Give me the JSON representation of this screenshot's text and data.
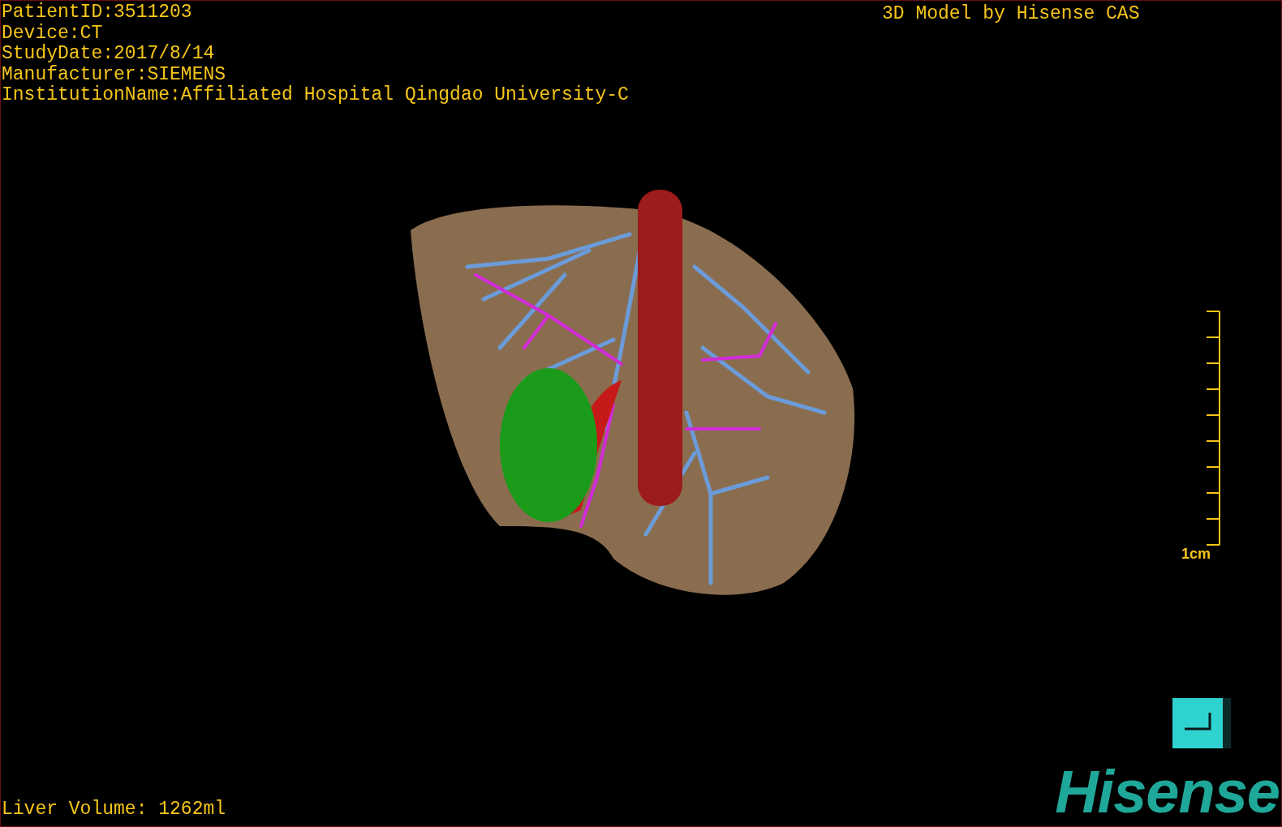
{
  "viewport": {
    "info_lines": [
      "PatientID:3511203",
      "Device:CT",
      "StudyDate:2017/8/14",
      "Manufacturer:SIEMENS",
      "InstitutionName:Affiliated Hospital Qingdao University-C"
    ],
    "model_caption": "3D Model by Hisense CAS",
    "scale_bar": {
      "label": "1cm"
    },
    "liver_volume": "Liver Volume: 1262ml",
    "logo": "Hisense"
  }
}
